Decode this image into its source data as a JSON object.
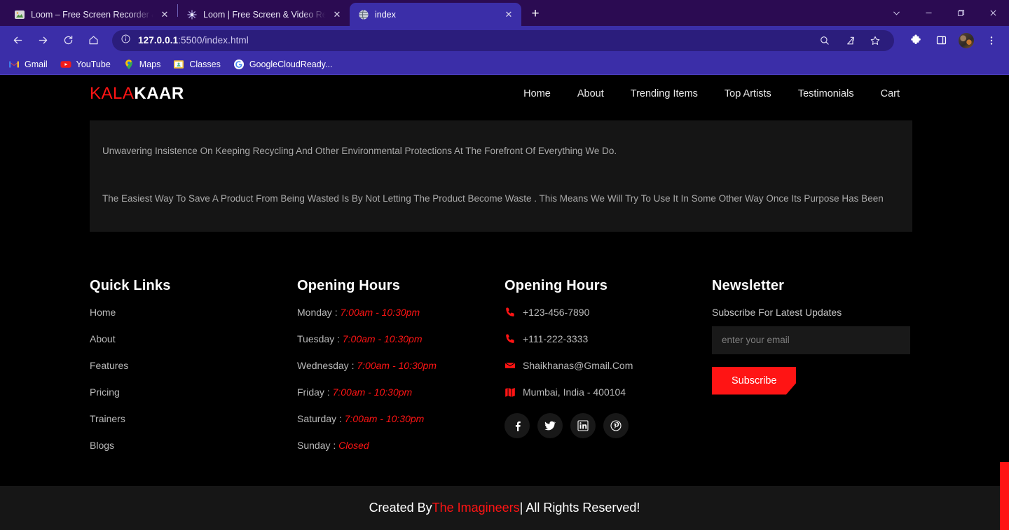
{
  "browser": {
    "tabs": [
      {
        "title": "Loom – Free Screen Recorder & S",
        "icon": "loom-app-icon",
        "active": false,
        "close_label": "✕"
      },
      {
        "title": "Loom | Free Screen & Video Reco",
        "icon": "loom-star-icon",
        "active": false,
        "close_label": "✕"
      },
      {
        "title": "index",
        "icon": "globe-icon",
        "active": true,
        "close_label": "✕"
      }
    ],
    "new_tab_label": "+",
    "window_controls": {
      "search_tabs": "chevron-down-icon",
      "minimize": "—",
      "maximize": "❐",
      "close": "✕"
    },
    "toolbar": {
      "back": "back-arrow-icon",
      "forward": "forward-arrow-icon",
      "reload": "reload-icon",
      "home": "home-icon",
      "site_info": "info-circle-icon",
      "url_host": "127.0.0.1",
      "url_path": ":5500/index.html",
      "zoom": "search-magnifier-icon",
      "share": "share-icon",
      "bookmark": "star-icon",
      "extensions": "puzzle-piece-icon",
      "side_panel": "side-panel-icon",
      "profile": "profile-avatar",
      "menu": "three-dot-menu-icon"
    },
    "bookmarks": [
      {
        "label": "Gmail",
        "icon": "gmail-icon"
      },
      {
        "label": "YouTube",
        "icon": "youtube-icon"
      },
      {
        "label": "Maps",
        "icon": "maps-pin-icon"
      },
      {
        "label": "Classes",
        "icon": "classroom-icon"
      },
      {
        "label": "GoogleCloudReady...",
        "icon": "google-icon"
      }
    ]
  },
  "site": {
    "logo": {
      "accent": "KALA",
      "rest": "KAAR"
    },
    "nav": [
      {
        "label": "Home"
      },
      {
        "label": "About"
      },
      {
        "label": "Trending Items"
      },
      {
        "label": "Top Artists"
      },
      {
        "label": "Testimonials"
      },
      {
        "label": "Cart"
      }
    ],
    "content": {
      "paragraph1": "Unwavering Insistence On Keeping Recycling And Other Environmental Protections At The Forefront Of Everything We Do.",
      "paragraph2": "The Easiest Way To Save A Product From Being Wasted Is By Not Letting The Product Become Waste . This Means We Will Try To Use It In Some Other Way Once Its Purpose Has Been"
    },
    "footer": {
      "quick_links": {
        "title": "Quick Links",
        "items": [
          {
            "label": "Home"
          },
          {
            "label": "About"
          },
          {
            "label": "Features"
          },
          {
            "label": "Pricing"
          },
          {
            "label": "Trainers"
          },
          {
            "label": "Blogs"
          }
        ]
      },
      "hours": {
        "title": "Opening Hours",
        "rows": [
          {
            "day": "Monday : ",
            "time": "7:00am - 10:30pm"
          },
          {
            "day": "Tuesday : ",
            "time": "7:00am - 10:30pm"
          },
          {
            "day": "Wednesday : ",
            "time": "7:00am - 10:30pm"
          },
          {
            "day": "Friday : ",
            "time": "7:00am - 10:30pm"
          },
          {
            "day": "Saturday : ",
            "time": "7:00am - 10:30pm"
          },
          {
            "day": "Sunday : ",
            "time": "Closed"
          }
        ]
      },
      "contact": {
        "title": "Opening Hours",
        "rows": [
          {
            "icon": "phone-icon",
            "text": "+123-456-7890"
          },
          {
            "icon": "phone-icon",
            "text": "+111-222-3333"
          },
          {
            "icon": "envelope-icon",
            "text": "Shaikhanas@Gmail.Com"
          },
          {
            "icon": "map-icon",
            "text": "Mumbai, India - 400104"
          }
        ],
        "socials": [
          {
            "name": "facebook-icon"
          },
          {
            "name": "twitter-icon"
          },
          {
            "name": "linkedin-icon"
          },
          {
            "name": "pinterest-icon"
          }
        ]
      },
      "newsletter": {
        "title": "Newsletter",
        "subtitle": "Subscribe For Latest Updates",
        "placeholder": "enter your email",
        "value": "",
        "button": "Subscribe"
      }
    },
    "credit": {
      "prefix": "Created By ",
      "brand": "The Imagineers",
      "suffix": " | All Rights Reserved!"
    },
    "colors": {
      "accent": "#ff1414",
      "background": "#000000",
      "panel": "#151515",
      "credit_bar": "#161616"
    }
  }
}
